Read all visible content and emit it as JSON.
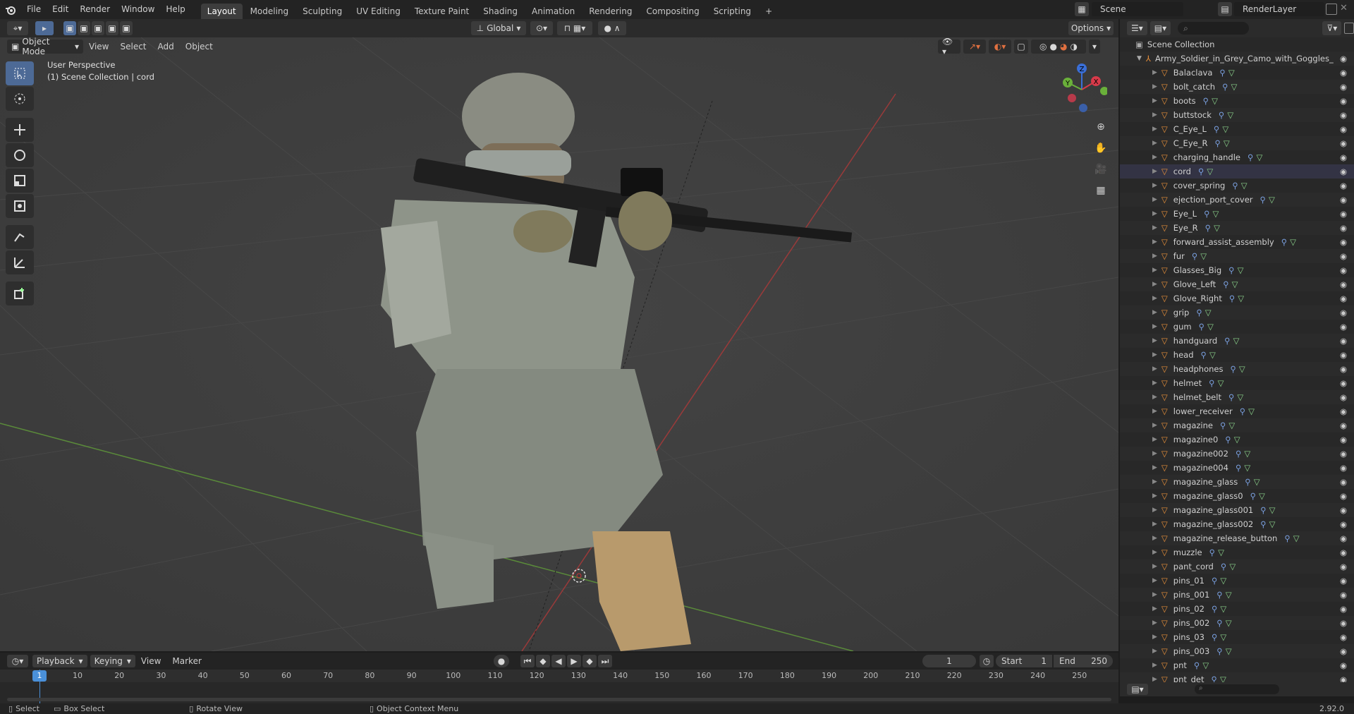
{
  "menu": [
    "File",
    "Edit",
    "Render",
    "Window",
    "Help"
  ],
  "workspace_tabs": [
    "Layout",
    "Modeling",
    "Sculpting",
    "UV Editing",
    "Texture Paint",
    "Shading",
    "Animation",
    "Rendering",
    "Compositing",
    "Scripting"
  ],
  "active_tab": "Layout",
  "scene_name": "Scene",
  "view_layer": "RenderLayer",
  "viewport": {
    "mode": "Object Mode",
    "menus": [
      "View",
      "Select",
      "Add",
      "Object"
    ],
    "orientation": "Global",
    "options": "Options",
    "overlay_line1": "User Perspective",
    "overlay_line2": "(1) Scene Collection | cord"
  },
  "gizmo": {
    "x": "X",
    "y": "Y",
    "z": "Z"
  },
  "outliner": {
    "root": "Scene Collection",
    "parent": "Army_Soldier_in_Grey_Camo_with_Goggles_",
    "items": [
      "Balaclava",
      "bolt_catch",
      "boots",
      "buttstock",
      "C_Eye_L",
      "C_Eye_R",
      "charging_handle",
      "cord",
      "cover_spring",
      "ejection_port_cover",
      "Eye_L",
      "Eye_R",
      "forward_assist_assembly",
      "fur",
      "Glasses_Big",
      "Glove_Left",
      "Glove_Right",
      "grip",
      "gum",
      "handguard",
      "head",
      "headphones",
      "helmet",
      "helmet_belt",
      "lower_receiver",
      "magazine",
      "magazine0",
      "magazine002",
      "magazine004",
      "magazine_glass",
      "magazine_glass0",
      "magazine_glass001",
      "magazine_glass002",
      "magazine_release_button",
      "muzzle",
      "pant_cord",
      "pins_01",
      "pins_001",
      "pins_02",
      "pins_002",
      "pins_03",
      "pins_003",
      "pnt",
      "pnt_det"
    ]
  },
  "timeline": {
    "menus": [
      "Playback",
      "Keying",
      "View",
      "Marker"
    ],
    "current_frame": "1",
    "start_label": "Start",
    "start": "1",
    "end_label": "End",
    "end": "250",
    "ticks": [
      "10",
      "20",
      "30",
      "40",
      "50",
      "60",
      "70",
      "80",
      "90",
      "100",
      "110",
      "120",
      "130",
      "140",
      "150",
      "160",
      "170",
      "180",
      "190",
      "200",
      "210",
      "220",
      "230",
      "240",
      "250"
    ]
  },
  "status": {
    "select": "Select",
    "box_select": "Box Select",
    "rotate": "Rotate View",
    "context": "Object Context Menu",
    "version": "2.92.0"
  }
}
